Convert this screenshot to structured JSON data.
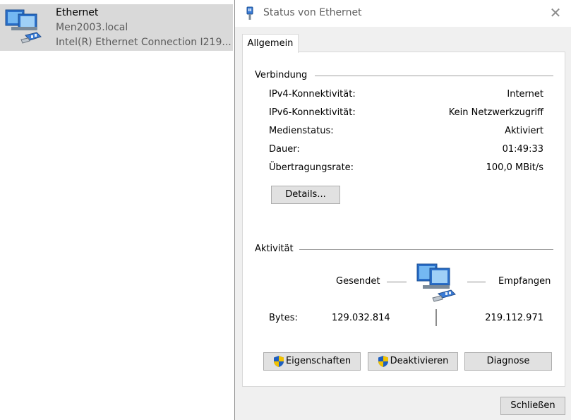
{
  "adapter": {
    "name": "Ethernet",
    "domain": "Men2003.local",
    "device": "Intel(R) Ethernet Connection I219..."
  },
  "dialog": {
    "title": "Status von Ethernet",
    "close_icon": "close-icon",
    "tab": "Allgemein",
    "connection": {
      "group_label": "Verbindung",
      "rows": [
        {
          "label": "IPv4-Konnektivität:",
          "value": "Internet"
        },
        {
          "label": "IPv6-Konnektivität:",
          "value": "Kein Netzwerkzugriff"
        },
        {
          "label": "Medienstatus:",
          "value": "Aktiviert"
        },
        {
          "label": "Dauer:",
          "value": "01:49:33"
        },
        {
          "label": "Übertragungsrate:",
          "value": "100,0 MBit/s"
        }
      ],
      "details_button": "Details..."
    },
    "activity": {
      "group_label": "Aktivität",
      "sent_label": "Gesendet",
      "received_label": "Empfangen",
      "bytes_label": "Bytes:",
      "bytes_sent": "129.032.814",
      "bytes_received": "219.112.971"
    },
    "buttons": {
      "properties": "Eigenschaften",
      "disable": "Deaktivieren",
      "diagnose": "Diagnose",
      "close": "Schließen"
    }
  },
  "colors": {
    "selection_bg": "#d9d9d9",
    "dialog_bg": "#f0f0f0",
    "button_bg": "#e1e1e1",
    "shield_blue": "#1f5fbf",
    "shield_yellow": "#f2c200"
  }
}
